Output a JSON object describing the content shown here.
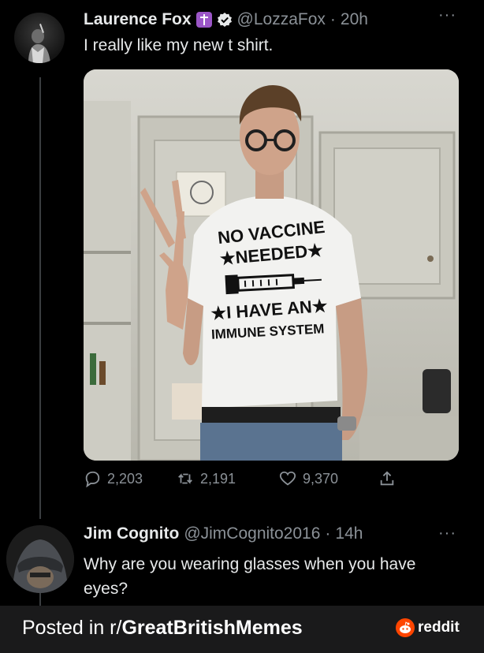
{
  "tweet1": {
    "display_name": "Laurence Fox",
    "handle": "@LozzaFox",
    "time": "20h",
    "text": "I really like my new t shirt.",
    "shirt_text": {
      "line1": "NO VACCINE",
      "line2": "★NEEDED★",
      "line3": "★I HAVE AN★",
      "line4": "IMMUNE SYSTEM"
    },
    "stats": {
      "replies": "2,203",
      "retweets": "2,191",
      "likes": "9,370"
    }
  },
  "tweet2": {
    "display_name": "Jim Cognito",
    "handle": "@JimCognito2016",
    "time": "14h",
    "text": "Why are you wearing glasses when you have eyes?"
  },
  "footer": {
    "posted_prefix": "Posted in r/",
    "subreddit": "GreatBritishMemes",
    "brand": "reddit"
  },
  "separator": "·",
  "more_glyph": "···",
  "colors": {
    "background": "#000000",
    "text": "#e7e9ea",
    "muted": "#8b9197",
    "verified": "#e7e9ea",
    "badge": "#9b56c7",
    "reddit": "#ff4500"
  }
}
